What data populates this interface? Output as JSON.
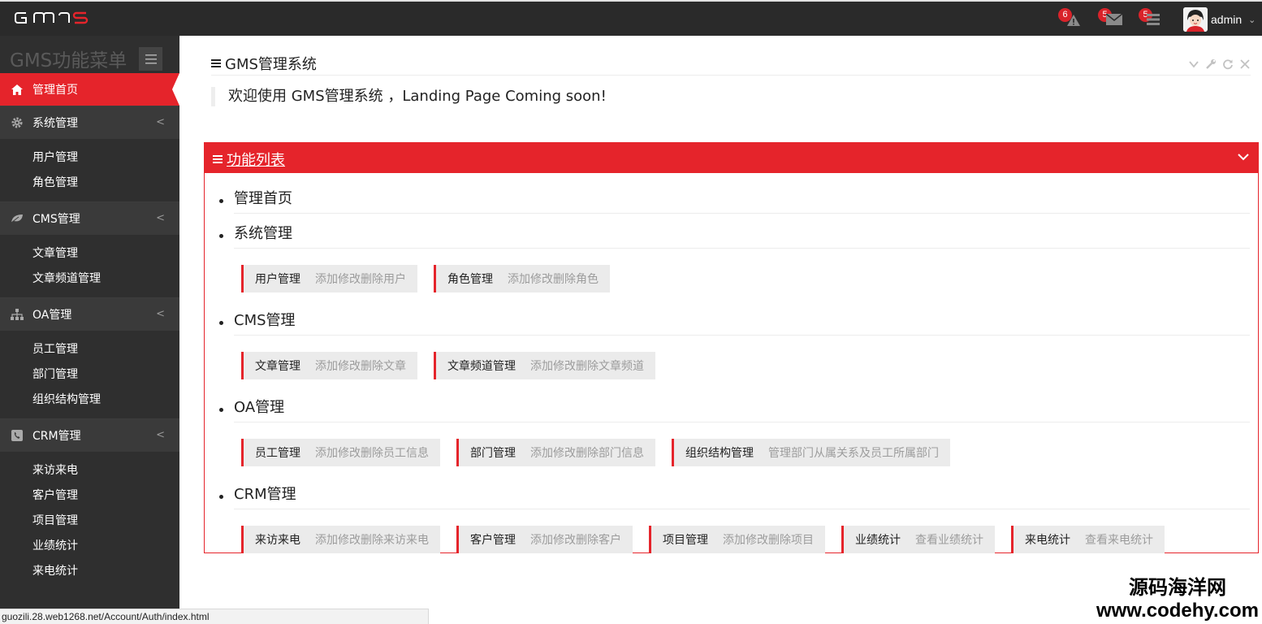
{
  "topbar": {
    "logo_text": "GMS",
    "notifications": [
      {
        "icon": "warning-icon",
        "count": "6"
      },
      {
        "icon": "envelope-icon",
        "count": "5"
      },
      {
        "icon": "tasks-icon",
        "count": "5"
      }
    ],
    "username": "admin"
  },
  "sidebar": {
    "title": "GMS功能菜单",
    "groups": [
      {
        "label": "管理首页",
        "icon": "home-icon",
        "active": true,
        "items": []
      },
      {
        "label": "系统管理",
        "icon": "gear-icon",
        "items": [
          "用户管理",
          "角色管理"
        ]
      },
      {
        "label": "CMS管理",
        "icon": "leaf-icon",
        "items": [
          "文章管理",
          "文章频道管理"
        ]
      },
      {
        "label": "OA管理",
        "icon": "sitemap-icon",
        "items": [
          "员工管理",
          "部门管理",
          "组织结构管理"
        ]
      },
      {
        "label": "CRM管理",
        "icon": "phone-icon",
        "items": [
          "来访来电",
          "客户管理",
          "项目管理",
          "业绩统计",
          "来电统计"
        ]
      }
    ]
  },
  "welcome": {
    "title": "GMS管理系统",
    "text": "欢迎使用 GMS管理系统 ，Landing Page Coming soon!"
  },
  "func_panel": {
    "title": "功能列表",
    "categories": [
      {
        "name": "管理首页",
        "items": []
      },
      {
        "name": "系统管理",
        "items": [
          {
            "name": "用户管理",
            "desc": "添加修改删除用户"
          },
          {
            "name": "角色管理",
            "desc": "添加修改删除角色"
          }
        ]
      },
      {
        "name": "CMS管理",
        "items": [
          {
            "name": "文章管理",
            "desc": "添加修改删除文章"
          },
          {
            "name": "文章频道管理",
            "desc": "添加修改删除文章频道"
          }
        ]
      },
      {
        "name": "OA管理",
        "items": [
          {
            "name": "员工管理",
            "desc": "添加修改删除员工信息"
          },
          {
            "name": "部门管理",
            "desc": "添加修改删除部门信息"
          },
          {
            "name": "组织结构管理",
            "desc": "管理部门从属关系及员工所属部门"
          }
        ]
      },
      {
        "name": "CRM管理",
        "items": [
          {
            "name": "来访来电",
            "desc": "添加修改删除来访来电"
          },
          {
            "name": "客户管理",
            "desc": "添加修改删除客户"
          },
          {
            "name": "项目管理",
            "desc": "添加修改删除项目"
          },
          {
            "name": "业绩统计",
            "desc": "查看业绩统计"
          },
          {
            "name": "来电统计",
            "desc": "查看来电统计"
          }
        ]
      }
    ]
  },
  "statusbar": {
    "url": "guozili.28.web1268.net/Account/Auth/index.html"
  },
  "watermark": {
    "line1": "源码海洋网",
    "line2": "www.codehy.com"
  },
  "colors": {
    "accent": "#e5242b",
    "topbar": "#2a2a2a",
    "sidebar": "#2f2f2f"
  }
}
